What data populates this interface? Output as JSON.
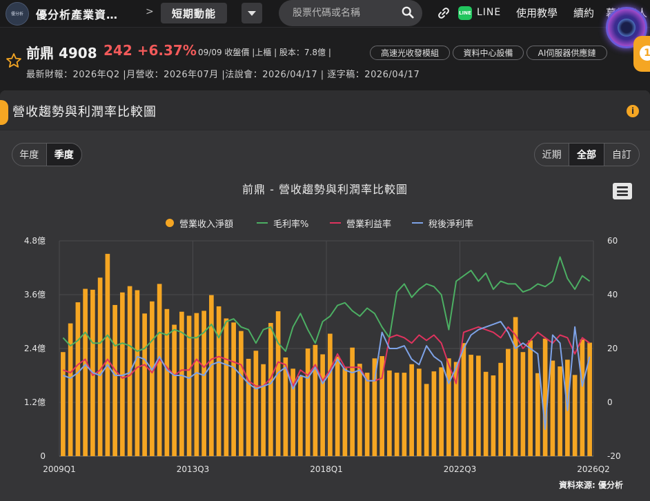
{
  "nav": {
    "logo_text": "優分析",
    "brand": "優分析產業資…",
    "crumb_sep": ">",
    "crumb_current": "短期動能",
    "search_placeholder": "股票代碼或名稱",
    "line_label": "LINE",
    "tutorial": "使用教學",
    "subscribe": "續約",
    "partial": "幕後達人"
  },
  "stock": {
    "name": "前鼎 4908",
    "price": "242 +6.37%",
    "meta": "09/09 收盤價 |上櫃 | 股本：7.8億 |",
    "tags": [
      "高速光收發模組",
      "資料中心設備",
      "AI伺服器供應鏈"
    ],
    "sub": "最新財報：2026年Q2 |月營收：2026年07月 |法說會：2026/04/17 | 逐字稿：2026/04/17",
    "badge": "1"
  },
  "panel": {
    "title": "營收趨勢與利潤率比較圖",
    "info": "i",
    "period_tabs": [
      "年度",
      "季度"
    ],
    "period_active": 1,
    "range_tabs": [
      "近期",
      "全部",
      "自訂"
    ],
    "range_active": 1,
    "source": "資料來源: 優分析"
  },
  "colors": {
    "revenue": "#f5a623",
    "gross": "#4caf63",
    "operating": "#e0335e",
    "net": "#7ea3e8"
  },
  "chart_data": {
    "type": "bar",
    "title": "前鼎 - 營收趨勢與利潤率比較圖",
    "x_ticks": [
      "2009Q1",
      "2013Q3",
      "2018Q1",
      "2022Q3",
      "2026Q2"
    ],
    "y_left": {
      "ticks": [
        "0",
        "1.2億",
        "2.4億",
        "3.6億",
        "4.8億"
      ],
      "range": [
        0,
        4.8
      ],
      "unit": "億"
    },
    "y_right": {
      "ticks": [
        "-20",
        "0",
        "20",
        "40",
        "60"
      ],
      "range": [
        -20,
        60
      ],
      "unit": "%"
    },
    "grid": true,
    "legend_position": "top-center",
    "series": [
      {
        "name": "營業收入淨額",
        "kind": "bar",
        "axis": "left",
        "values": [
          2.32,
          2.96,
          3.43,
          3.73,
          3.71,
          3.98,
          4.51,
          3.37,
          3.65,
          3.79,
          3.7,
          3.18,
          3.45,
          3.84,
          3.28,
          2.93,
          3.22,
          3.13,
          3.19,
          3.24,
          3.59,
          3.34,
          3.07,
          2.98,
          2.79,
          2.17,
          2.35,
          2.05,
          2.97,
          3.23,
          2.2,
          1.95,
          1.78,
          2.4,
          2.48,
          2.27,
          2.73,
          2.22,
          1.96,
          2.42,
          2.06,
          1.86,
          2.18,
          2.23,
          1.91,
          1.86,
          1.86,
          2.05,
          1.95,
          1.61,
          1.89,
          1.98,
          2.18,
          2.1,
          2.52,
          2.26,
          2.24,
          1.88,
          1.8,
          2.08,
          2.39,
          3.1,
          2.32,
          2.58,
          1.85,
          2.62,
          2.13,
          2.0,
          2.15,
          1.81,
          2.6,
          2.53
        ]
      },
      {
        "name": "毛利率%",
        "kind": "line",
        "axis": "right",
        "values": [
          24,
          21,
          23,
          26,
          22,
          22,
          25,
          21,
          22,
          21,
          19,
          20,
          23,
          26,
          25,
          27,
          26,
          24,
          24,
          26,
          29,
          24,
          30,
          31,
          28,
          27,
          22,
          27,
          28,
          22,
          19,
          28,
          33,
          27,
          22,
          30,
          32,
          36,
          37,
          34,
          32,
          35,
          33,
          28,
          24,
          41,
          44,
          39,
          42,
          44,
          43,
          40,
          27,
          45,
          47,
          49,
          45,
          48,
          42,
          45,
          44,
          44,
          41,
          42,
          44,
          43,
          45,
          54,
          46,
          42,
          47,
          45
        ]
      },
      {
        "name": "營業利益率",
        "kind": "line",
        "axis": "right",
        "values": [
          12,
          11,
          14,
          16,
          10,
          12,
          16,
          12,
          9,
          10,
          13,
          14,
          11,
          16,
          13,
          10,
          12,
          12,
          16,
          13,
          16,
          17,
          16,
          15,
          14,
          8,
          6,
          6,
          9,
          15,
          14,
          6,
          12,
          10,
          14,
          8,
          12,
          18,
          13,
          13,
          13,
          8,
          8,
          9,
          24,
          25,
          24,
          22,
          25,
          23,
          25,
          22,
          14,
          7,
          26,
          27,
          28,
          27,
          26,
          24,
          28,
          25,
          20,
          23,
          26,
          24,
          22,
          25,
          24,
          18,
          24,
          22
        ]
      },
      {
        "name": "稅後淨利率",
        "kind": "line",
        "axis": "right",
        "values": [
          10,
          9,
          11,
          14,
          11,
          10,
          14,
          10,
          10,
          11,
          17,
          16,
          12,
          17,
          12,
          10,
          10,
          9,
          11,
          10,
          14,
          15,
          14,
          13,
          10,
          7,
          5,
          6,
          7,
          11,
          13,
          5,
          10,
          9,
          13,
          7,
          11,
          16,
          12,
          11,
          12,
          8,
          8,
          26,
          20,
          20,
          21,
          16,
          14,
          21,
          17,
          15,
          7,
          13,
          20,
          25,
          27,
          28,
          29,
          30,
          26,
          20,
          22,
          20,
          18,
          -10,
          25,
          22,
          -3,
          28,
          6,
          17
        ]
      }
    ]
  }
}
